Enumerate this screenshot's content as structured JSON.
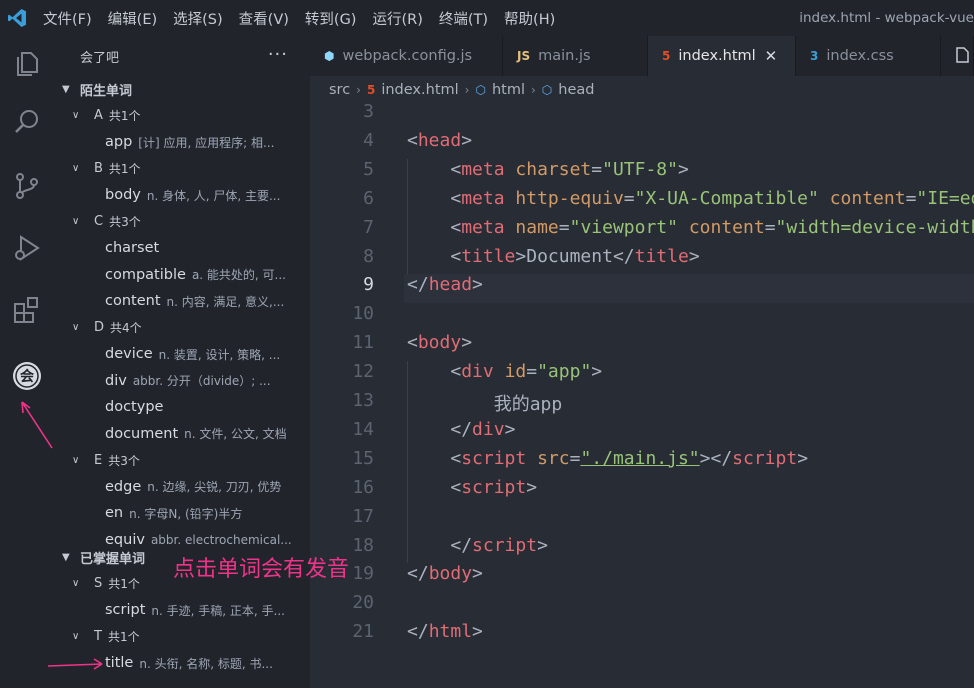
{
  "titlebar": {
    "menus": [
      "文件(F)",
      "编辑(E)",
      "选择(S)",
      "查看(V)",
      "转到(G)",
      "运行(R)",
      "终端(T)",
      "帮助(H)"
    ],
    "window_title": "index.html - webpack-vue"
  },
  "activity_icons": [
    "explorer-icon",
    "search-icon",
    "source-control-icon",
    "run-debug-icon",
    "extensions-icon",
    "hui-extension-icon"
  ],
  "sidebar": {
    "title": "会了吧",
    "more": "···",
    "sections": [
      {
        "label": "陌生单词",
        "groups": [
          {
            "letter": "A",
            "count": "共1个",
            "words": [
              {
                "word": "app",
                "meaning": "[计] 应用, 应用程序; 相..."
              }
            ]
          },
          {
            "letter": "B",
            "count": "共1个",
            "words": [
              {
                "word": "body",
                "meaning": "n. 身体, 人, 尸体, 主要..."
              }
            ]
          },
          {
            "letter": "C",
            "count": "共3个",
            "words": [
              {
                "word": "charset",
                "meaning": ""
              },
              {
                "word": "compatible",
                "meaning": "a. 能共处的, 可..."
              },
              {
                "word": "content",
                "meaning": "n. 内容, 满足, 意义,..."
              }
            ]
          },
          {
            "letter": "D",
            "count": "共4个",
            "words": [
              {
                "word": "device",
                "meaning": "n. 装置, 设计, 策略, ..."
              },
              {
                "word": "div",
                "meaning": "abbr. 分开（divide）; ..."
              },
              {
                "word": "doctype",
                "meaning": ""
              },
              {
                "word": "document",
                "meaning": "n. 文件, 公文, 文档"
              }
            ]
          },
          {
            "letter": "E",
            "count": "共3个",
            "words": [
              {
                "word": "edge",
                "meaning": "n. 边缘, 尖锐, 刀刃, 优势"
              },
              {
                "word": "en",
                "meaning": "n. 字母N, (铅字)半方"
              },
              {
                "word": "equiv",
                "meaning": "abbr. electrochemical..."
              }
            ]
          }
        ]
      },
      {
        "label": "已掌握单词",
        "groups": [
          {
            "letter": "S",
            "count": "共1个",
            "words": [
              {
                "word": "script",
                "meaning": "n. 手迹, 手稿, 正本, 手..."
              }
            ]
          },
          {
            "letter": "T",
            "count": "共1个",
            "words": [
              {
                "word": "title",
                "meaning": "n. 头衔, 名称, 标题, 书..."
              }
            ]
          }
        ]
      }
    ]
  },
  "tabs": [
    {
      "label": "webpack.config.js",
      "icon": "webpack-icon",
      "icon_text": "⬢",
      "active": false
    },
    {
      "label": "main.js",
      "icon": "js-icon",
      "icon_text": "JS",
      "active": false
    },
    {
      "label": "index.html",
      "icon": "html5-icon",
      "icon_text": "5",
      "active": true,
      "close": "✕"
    },
    {
      "label": "index.css",
      "icon": "css3-icon",
      "icon_text": "3",
      "active": false
    },
    {
      "label": "",
      "icon": "file-icon",
      "icon_text": "",
      "active": false
    }
  ],
  "breadcrumb": [
    "src",
    "index.html",
    "html",
    "head"
  ],
  "editor": {
    "active_line": "9",
    "lines": [
      {
        "n": "3",
        "tokens": []
      },
      {
        "n": "4",
        "tokens": [
          [
            "punc",
            "<"
          ],
          [
            "tag",
            "head"
          ],
          [
            "punc",
            ">"
          ]
        ]
      },
      {
        "n": "5",
        "tokens": [
          [
            "txt",
            "    "
          ],
          [
            "punc",
            "<"
          ],
          [
            "tag",
            "meta"
          ],
          [
            "txt",
            " "
          ],
          [
            "attr",
            "charset"
          ],
          [
            "punc",
            "="
          ],
          [
            "str",
            "\"UTF-8\""
          ],
          [
            "punc",
            ">"
          ]
        ]
      },
      {
        "n": "6",
        "tokens": [
          [
            "txt",
            "    "
          ],
          [
            "punc",
            "<"
          ],
          [
            "tag",
            "meta"
          ],
          [
            "txt",
            " "
          ],
          [
            "attr",
            "http-equiv"
          ],
          [
            "punc",
            "="
          ],
          [
            "str",
            "\"X-UA-Compatible\""
          ],
          [
            "txt",
            " "
          ],
          [
            "attr",
            "content"
          ],
          [
            "punc",
            "="
          ],
          [
            "str",
            "\"IE=edge\""
          ],
          [
            "punc",
            ">"
          ]
        ]
      },
      {
        "n": "7",
        "tokens": [
          [
            "txt",
            "    "
          ],
          [
            "punc",
            "<"
          ],
          [
            "tag",
            "meta"
          ],
          [
            "txt",
            " "
          ],
          [
            "attr",
            "name"
          ],
          [
            "punc",
            "="
          ],
          [
            "str",
            "\"viewport\""
          ],
          [
            "txt",
            " "
          ],
          [
            "attr",
            "content"
          ],
          [
            "punc",
            "="
          ],
          [
            "str",
            "\"width=device-width\""
          ],
          [
            "punc",
            ">"
          ]
        ]
      },
      {
        "n": "8",
        "tokens": [
          [
            "txt",
            "    "
          ],
          [
            "punc",
            "<"
          ],
          [
            "tag",
            "title"
          ],
          [
            "punc",
            ">"
          ],
          [
            "txt",
            "Document"
          ],
          [
            "punc",
            "</"
          ],
          [
            "tag",
            "title"
          ],
          [
            "punc",
            ">"
          ]
        ]
      },
      {
        "n": "9",
        "tokens": [
          [
            "punc",
            "</"
          ],
          [
            "tag",
            "head"
          ],
          [
            "punc",
            ">"
          ]
        ]
      },
      {
        "n": "10",
        "tokens": []
      },
      {
        "n": "11",
        "tokens": [
          [
            "punc",
            "<"
          ],
          [
            "tag",
            "body"
          ],
          [
            "punc",
            ">"
          ]
        ]
      },
      {
        "n": "12",
        "tokens": [
          [
            "txt",
            "    "
          ],
          [
            "punc",
            "<"
          ],
          [
            "tag",
            "div"
          ],
          [
            "txt",
            " "
          ],
          [
            "attr",
            "id"
          ],
          [
            "punc",
            "="
          ],
          [
            "str",
            "\"app\""
          ],
          [
            "punc",
            ">"
          ]
        ]
      },
      {
        "n": "13",
        "tokens": [
          [
            "txt",
            "        我的app"
          ]
        ]
      },
      {
        "n": "14",
        "tokens": [
          [
            "txt",
            "    "
          ],
          [
            "punc",
            "</"
          ],
          [
            "tag",
            "div"
          ],
          [
            "punc",
            ">"
          ]
        ]
      },
      {
        "n": "15",
        "tokens": [
          [
            "txt",
            "    "
          ],
          [
            "punc",
            "<"
          ],
          [
            "tag",
            "script"
          ],
          [
            "txt",
            " "
          ],
          [
            "attr",
            "src"
          ],
          [
            "punc",
            "="
          ],
          [
            "str",
            "\"./main.js\""
          ],
          [
            "punc",
            "></"
          ],
          [
            "tag",
            "script"
          ],
          [
            "punc",
            ">"
          ]
        ]
      },
      {
        "n": "16",
        "tokens": [
          [
            "txt",
            "    "
          ],
          [
            "punc",
            "<"
          ],
          [
            "tag",
            "script"
          ],
          [
            "punc",
            ">"
          ]
        ]
      },
      {
        "n": "17",
        "tokens": []
      },
      {
        "n": "18",
        "tokens": [
          [
            "txt",
            "    "
          ],
          [
            "punc",
            "</"
          ],
          [
            "tag",
            "script"
          ],
          [
            "punc",
            ">"
          ]
        ]
      },
      {
        "n": "19",
        "tokens": [
          [
            "punc",
            "</"
          ],
          [
            "tag",
            "body"
          ],
          [
            "punc",
            ">"
          ]
        ]
      },
      {
        "n": "20",
        "tokens": []
      },
      {
        "n": "21",
        "tokens": [
          [
            "punc",
            "</"
          ],
          [
            "tag",
            "html"
          ],
          [
            "punc",
            ">"
          ]
        ]
      }
    ]
  },
  "annotation": {
    "text": "点击单词会有发音",
    "color": "#f0338a"
  },
  "colors": {
    "tag": "#e06c75",
    "attr": "#d19a66",
    "string": "#98c379",
    "accent": "#61afef"
  }
}
